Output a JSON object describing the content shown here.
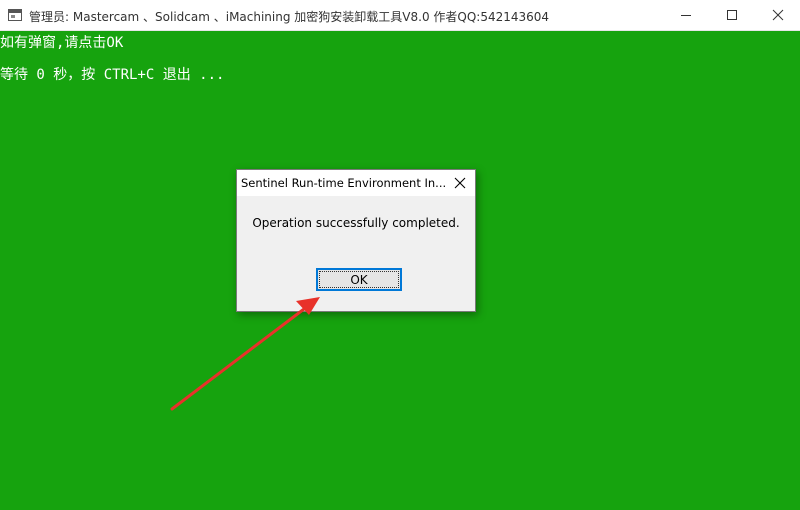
{
  "window": {
    "title": "管理员:  Mastercam 、Solidcam  、iMachining 加密狗安装卸载工具V8.0  作者QQ:542143604"
  },
  "console": {
    "lines": [
      "如有弹窗,请点击OK",
      "等待 0 秒，按 CTRL+C 退出 ..."
    ],
    "background": "#16a30e",
    "text_color": "#ffffff"
  },
  "dialog": {
    "title": "Sentinel Run-time Environment In...",
    "message": "Operation successfully completed.",
    "ok_label": "OK"
  },
  "annotation": {
    "arrow_color": "#e8322a"
  },
  "icons": {
    "app": "console-window-icon",
    "minimize": "minimize-icon",
    "maximize": "maximize-icon",
    "close": "close-icon"
  }
}
